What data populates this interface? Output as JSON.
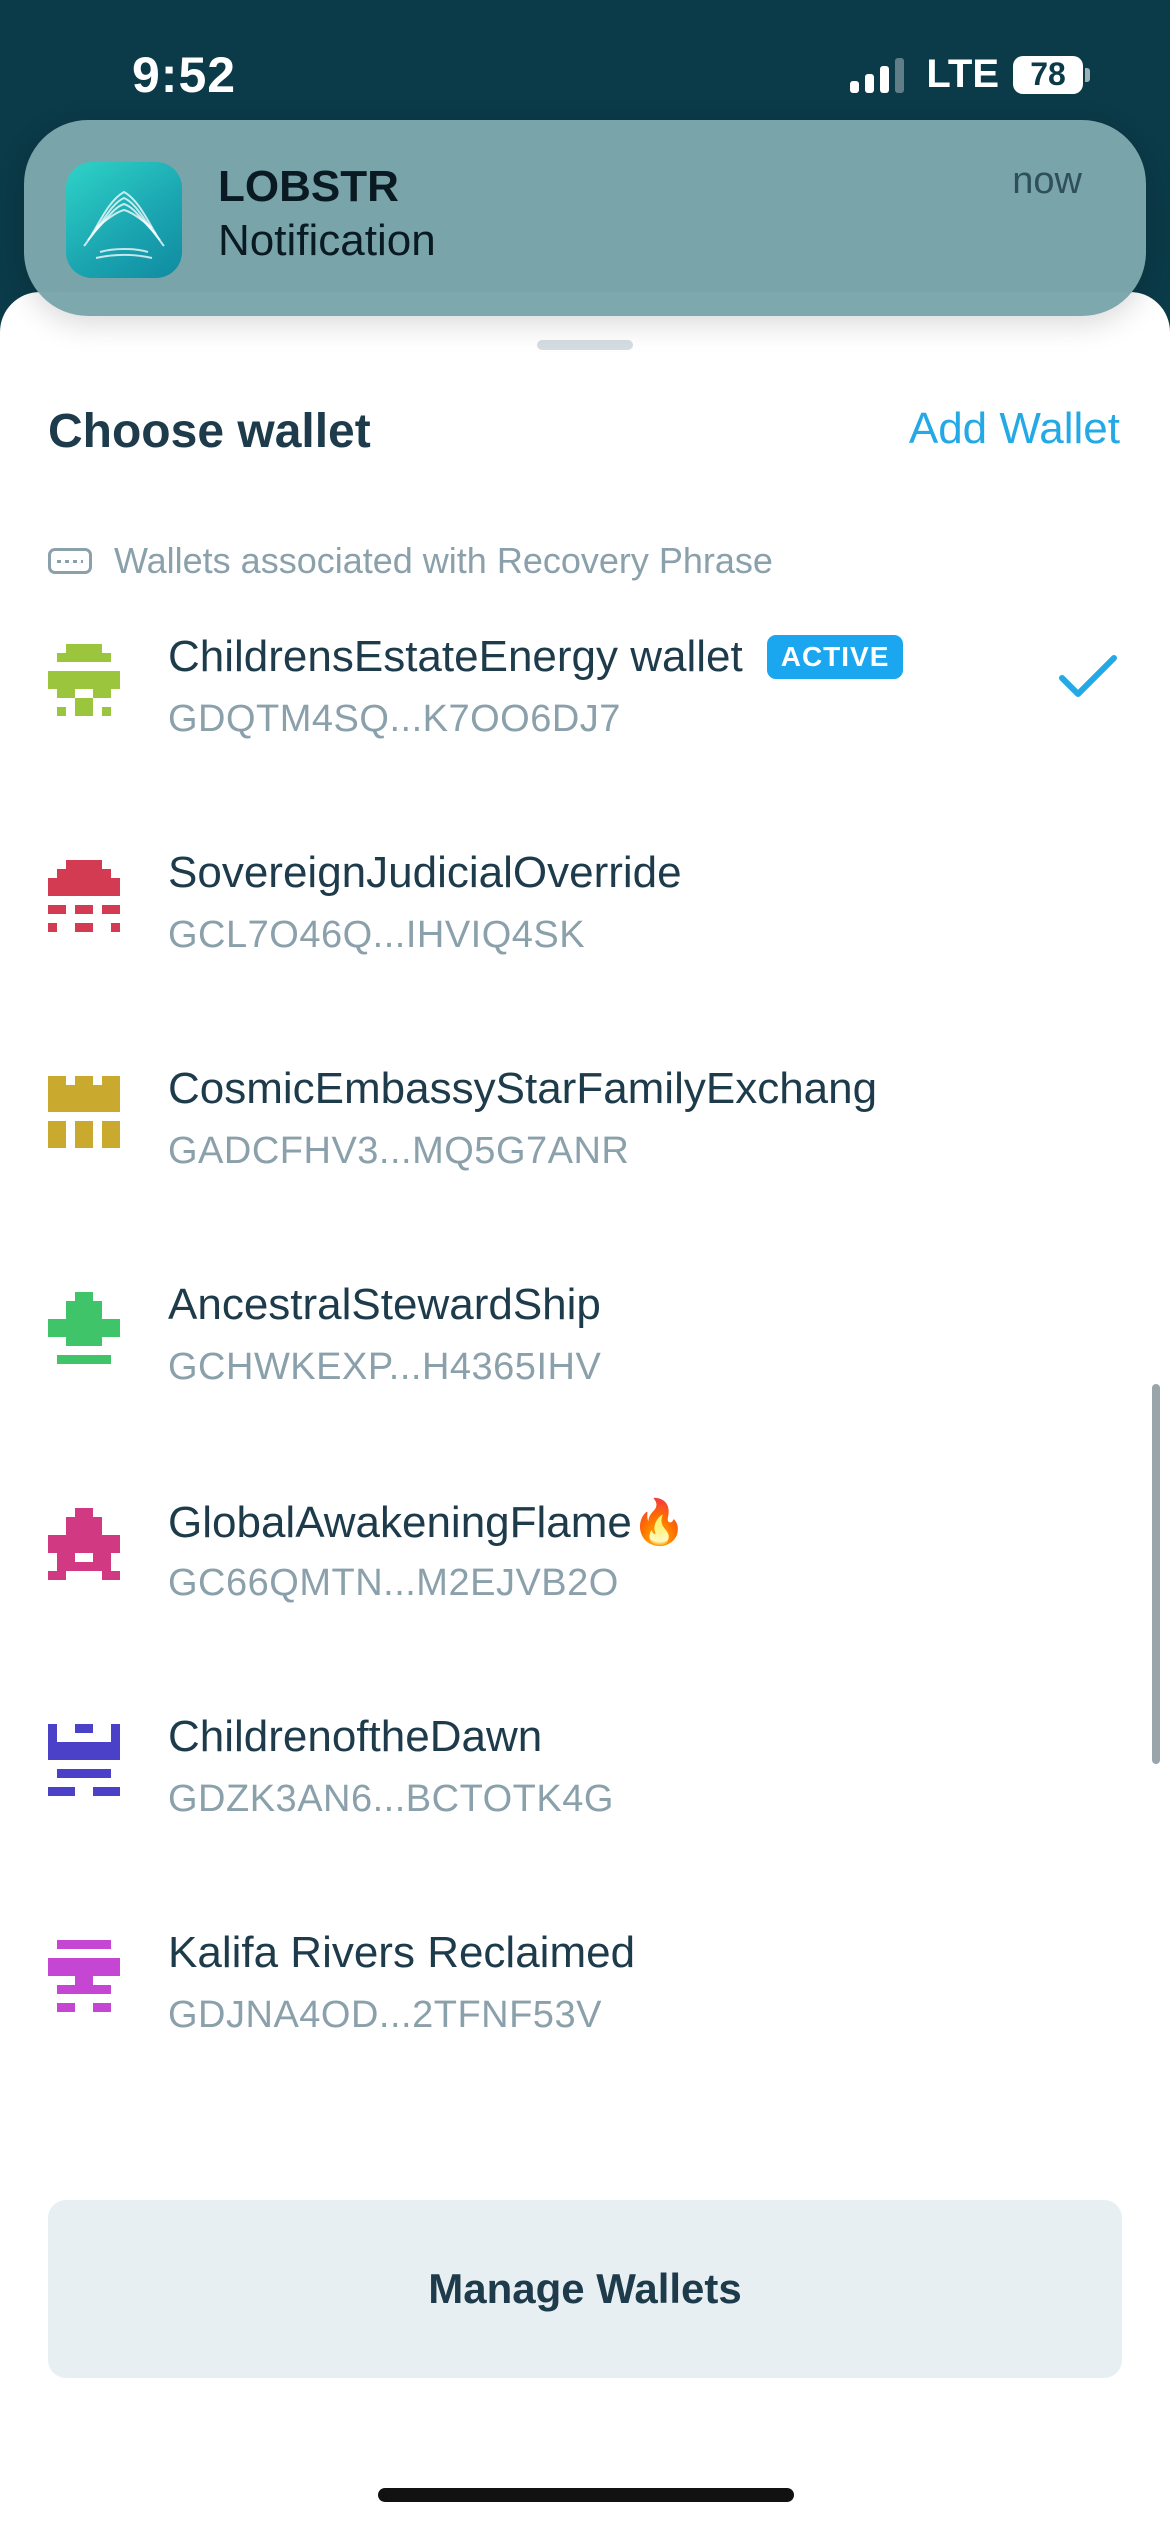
{
  "status_bar": {
    "time": "9:52",
    "network": "LTE",
    "battery": "78"
  },
  "notification": {
    "app": "LOBSTR",
    "body": "Notification",
    "time": "now",
    "icon": "lobstr-app-icon"
  },
  "sheet": {
    "title": "Choose wallet",
    "add_wallet": "Add Wallet",
    "section_label": "Wallets associated with Recovery Phrase",
    "section_icon": "keyboard-icon",
    "active_badge": "ACTIVE",
    "manage_button": "Manage Wallets"
  },
  "wallets": [
    {
      "name": "ChildrensEstateEnergy wallet",
      "address": "GDQTM4SQ...K7OO6DJ7",
      "active": true,
      "avatar_color": "#9bc53d"
    },
    {
      "name": "SovereignJudicialOverride",
      "address": "GCL7O46Q...IHVIQ4SK",
      "active": false,
      "avatar_color": "#d33b52"
    },
    {
      "name": "CosmicEmbassyStarFamilyExchang",
      "address": "GADCFHV3...MQ5G7ANR",
      "active": false,
      "avatar_color": "#c9aa2e"
    },
    {
      "name": "AncestralStewardShip",
      "address": "GCHWKEXP...H4365IHV",
      "active": false,
      "avatar_color": "#3fc46a"
    },
    {
      "name": "GlobalAwakeningFlame🔥",
      "address": "GC66QMTN...M2EJVB2O",
      "active": false,
      "avatar_color": "#d13a82"
    },
    {
      "name": "ChildrenoftheDawn",
      "address": "GDZK3AN6...BCTOTK4G",
      "active": false,
      "avatar_color": "#4b41c8"
    },
    {
      "name": "Kalifa Rivers Reclaimed",
      "address": "GDJNA4OD...2TFNF53V",
      "active": false,
      "avatar_color": "#c646d4"
    }
  ],
  "colors": {
    "accent": "#23a9e6",
    "badge": "#1aa7ef",
    "header_bg": "#0b3a48"
  }
}
